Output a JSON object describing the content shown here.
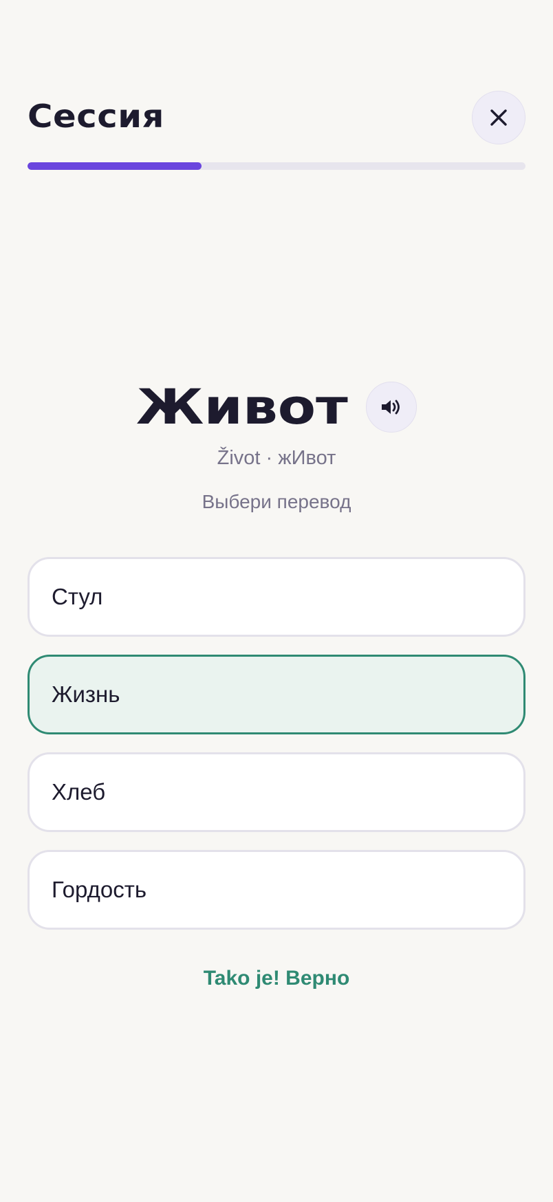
{
  "header": {
    "title": "Сессия"
  },
  "progress": {
    "fraction": 0.35
  },
  "card": {
    "word": "Живот",
    "transliteration": "Život · жИвот",
    "instruction": "Выбери перевод"
  },
  "options": [
    {
      "label": "Стул",
      "state": "default"
    },
    {
      "label": "Жизнь",
      "state": "correct"
    },
    {
      "label": "Хлеб",
      "state": "default"
    },
    {
      "label": "Гордость",
      "state": "default"
    }
  ],
  "feedback": {
    "text": "Tako je! Верно"
  },
  "icons": {
    "close": "close-icon",
    "audio": "speaker-icon"
  },
  "colors": {
    "accent": "#6a46de",
    "success": "#2f8a73",
    "background": "#f8f7f4"
  }
}
